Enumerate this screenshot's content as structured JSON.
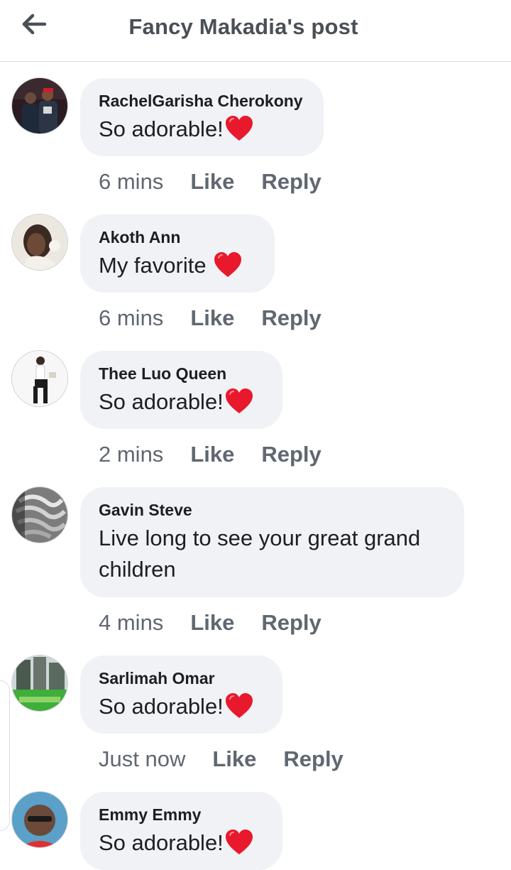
{
  "header": {
    "title": "Fancy Makadia's post",
    "back_icon": "arrow-left-icon"
  },
  "comments": [
    {
      "author": "RachelGarisha Cherokony",
      "text": "So adorable!",
      "has_heart": true,
      "time": "6 mins",
      "like_label": "Like",
      "reply_label": "Reply"
    },
    {
      "author": "Akoth Ann",
      "text": "My favorite ",
      "has_heart": true,
      "time": "6 mins",
      "like_label": "Like",
      "reply_label": "Reply"
    },
    {
      "author": "Thee Luo Queen",
      "text": "So adorable!",
      "has_heart": true,
      "time": "2 mins",
      "like_label": "Like",
      "reply_label": "Reply"
    },
    {
      "author": "Gavin Steve",
      "text": "Live long to see your great grand children",
      "has_heart": false,
      "time": "4 mins",
      "like_label": "Like",
      "reply_label": "Reply"
    },
    {
      "author": "Sarlimah Omar",
      "text": "So adorable!",
      "has_heart": true,
      "time": "Just now",
      "like_label": "Like",
      "reply_label": "Reply"
    },
    {
      "author": "Emmy Emmy",
      "text": "So adorable!",
      "has_heart": true,
      "time": "",
      "like_label": "",
      "reply_label": ""
    }
  ],
  "colors": {
    "bubble": "#f0f2f5",
    "heart": "#e8192c",
    "meta_text": "#606770",
    "title_text": "#4b4f56"
  }
}
